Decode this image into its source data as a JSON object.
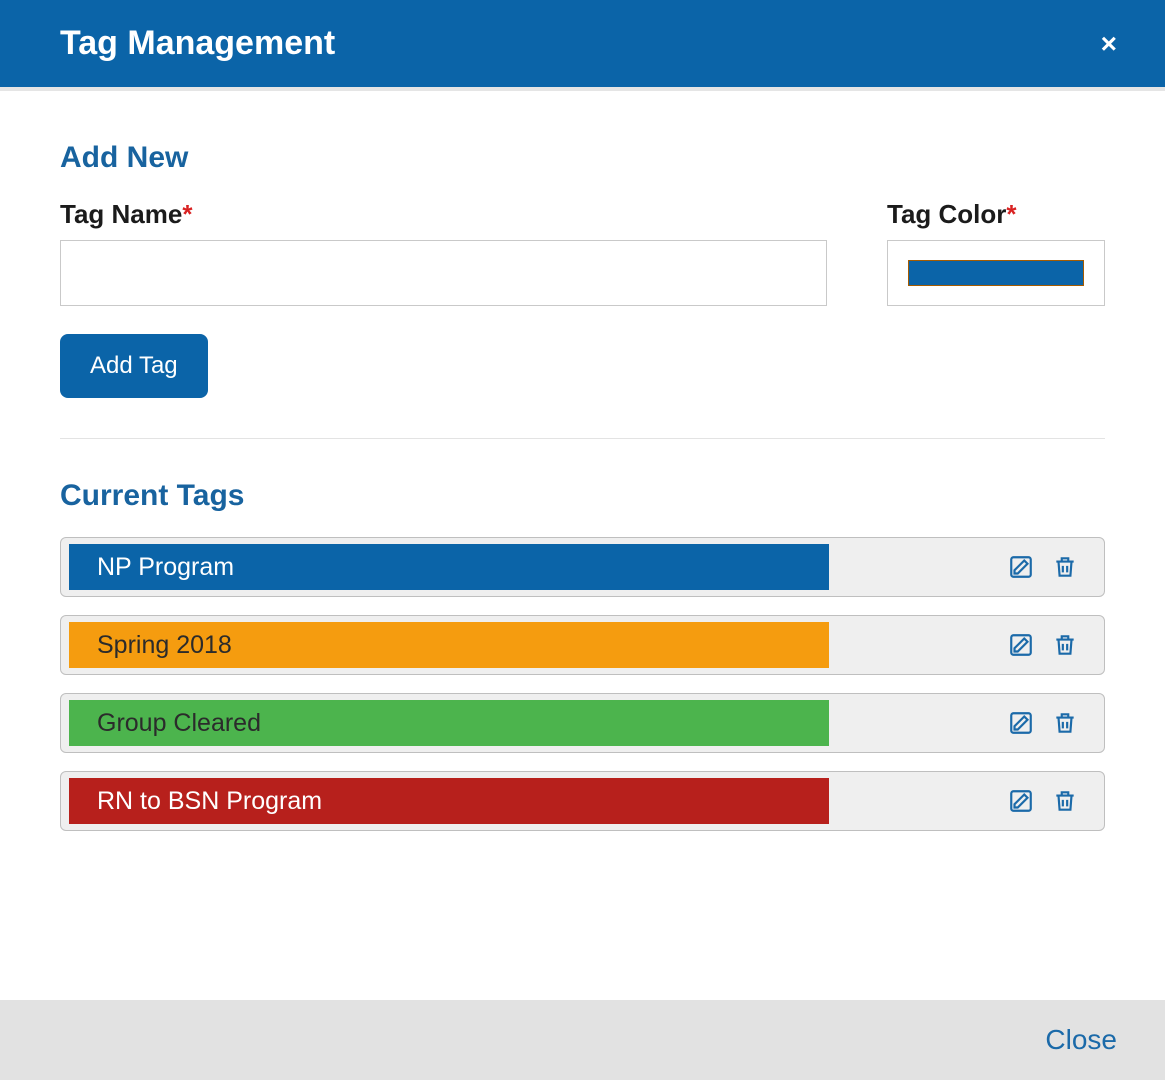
{
  "modal": {
    "title": "Tag Management",
    "close_x": "×"
  },
  "add_new": {
    "section_label": "Add New",
    "name_label": "Tag Name",
    "color_label": "Tag Color",
    "required_mark": "*",
    "add_button": "Add Tag",
    "color_value": "#0b64a8"
  },
  "current_tags": {
    "section_label": "Current Tags",
    "items": [
      {
        "name": "NP Program",
        "color": "#0b64a8",
        "text": "white"
      },
      {
        "name": "Spring 2018",
        "color": "#f59c0f",
        "text": "dark"
      },
      {
        "name": "Group Cleared",
        "color": "#4cb44d",
        "text": "dark"
      },
      {
        "name": "RN to BSN Program",
        "color": "#b7201c",
        "text": "white"
      }
    ]
  },
  "footer": {
    "close": "Close"
  }
}
